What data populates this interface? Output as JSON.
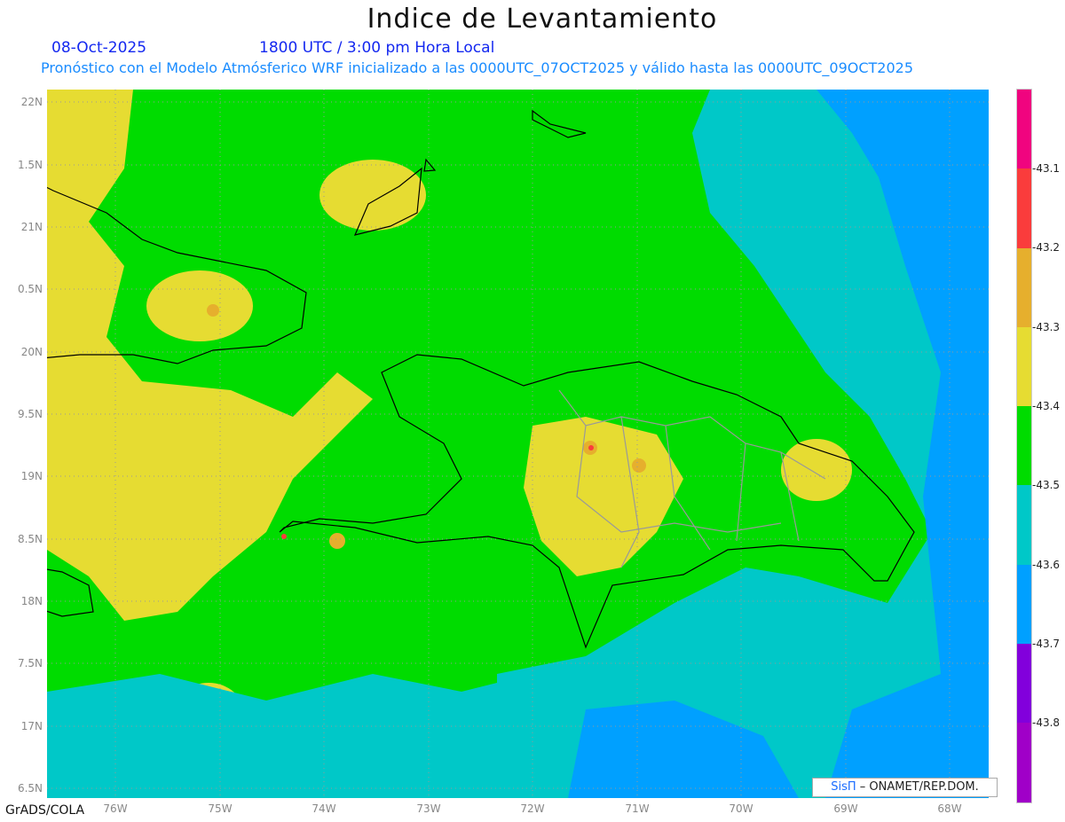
{
  "header": {
    "title": "Indice de Levantamiento",
    "date": "08-Oct-2025",
    "time": "1800 UTC / 3:00 pm Hora Local",
    "subtitle": "Pronóstico con el Modelo Atmósferico WRF inicializado a las 0000UTC_07OCT2025 y válido hasta las  0000UTC_09OCT2025"
  },
  "axes": {
    "lat_labels": [
      "22N",
      "1.5N",
      "21N",
      "0.5N",
      "20N",
      "9.5N",
      "19N",
      "8.5N",
      "18N",
      "7.5N",
      "17N",
      "6.5N"
    ],
    "lon_labels": [
      "76W",
      "75W",
      "74W",
      "73W",
      "72W",
      "71W",
      "70W",
      "69W",
      "68W"
    ]
  },
  "colorbar": {
    "colors": [
      "#f0047f",
      "#fa3c3c",
      "#e6af2d",
      "#e6dc32",
      "#00dc00",
      "#00c8c8",
      "#00a0ff",
      "#8200dc",
      "#a000c8"
    ],
    "labels": [
      "-43.1",
      "-43.2",
      "-43.3",
      "-43.4",
      "-43.5",
      "-43.6",
      "-43.7",
      "-43.8"
    ]
  },
  "footer": {
    "credit": "GrADS/COLA",
    "logo_sis": "SisΠ",
    "logo_text": "– ONAMET/REP.DOM."
  }
}
